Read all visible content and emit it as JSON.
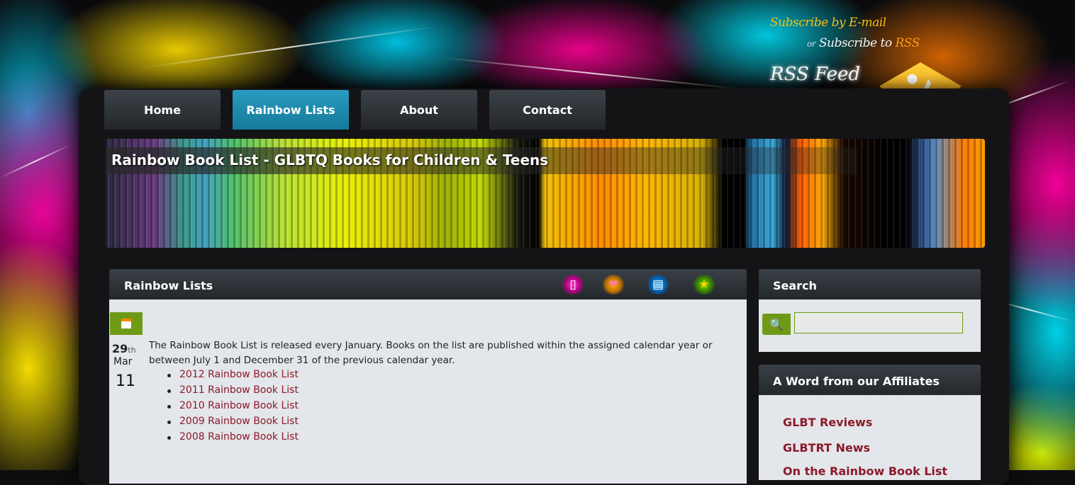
{
  "subscribe": {
    "email_text": "Subscribe by E-mail",
    "or_text": "or",
    "rss_prefix": "Subscribe to",
    "rss_highlight": "RSS",
    "feed_label": "RSS Feed"
  },
  "nav": {
    "items": [
      {
        "label": "Home",
        "active": false
      },
      {
        "label": "Rainbow Lists",
        "active": true
      },
      {
        "label": "About",
        "active": false
      },
      {
        "label": "Contact",
        "active": false
      }
    ]
  },
  "banner": {
    "title": "Rainbow Book List - GLBTQ Books for Children & Teens"
  },
  "main_panel": {
    "title": "Rainbow Lists",
    "action_icons": [
      "comment-icon",
      "heart-add-icon",
      "document-add-icon",
      "star-icon"
    ],
    "post_date": {
      "day": "29",
      "suffix": "th",
      "month": "Mar",
      "year": "11"
    },
    "intro": "The Rainbow Book List is released every January. Books on the list are published within the assigned calendar year or between July 1 and December 31 of the previous calendar year.",
    "links": [
      "2012 Rainbow Book List",
      "2011 Rainbow Book List",
      "2010 Rainbow Book List",
      "2009 Rainbow Book List",
      "2008 Rainbow Book List"
    ]
  },
  "sidebar": {
    "search_title": "Search",
    "search_value": "",
    "affiliates_title": "A Word from our Affiliates",
    "affiliate_links": [
      "GLBT Reviews",
      "GLBTRT News",
      "On the Rainbow Book List"
    ]
  },
  "colors": {
    "nav_active": "#1e8fb4",
    "accent_green": "#6f9a16",
    "link": "#8b1a2a",
    "rss_orange": "#f5a316"
  }
}
